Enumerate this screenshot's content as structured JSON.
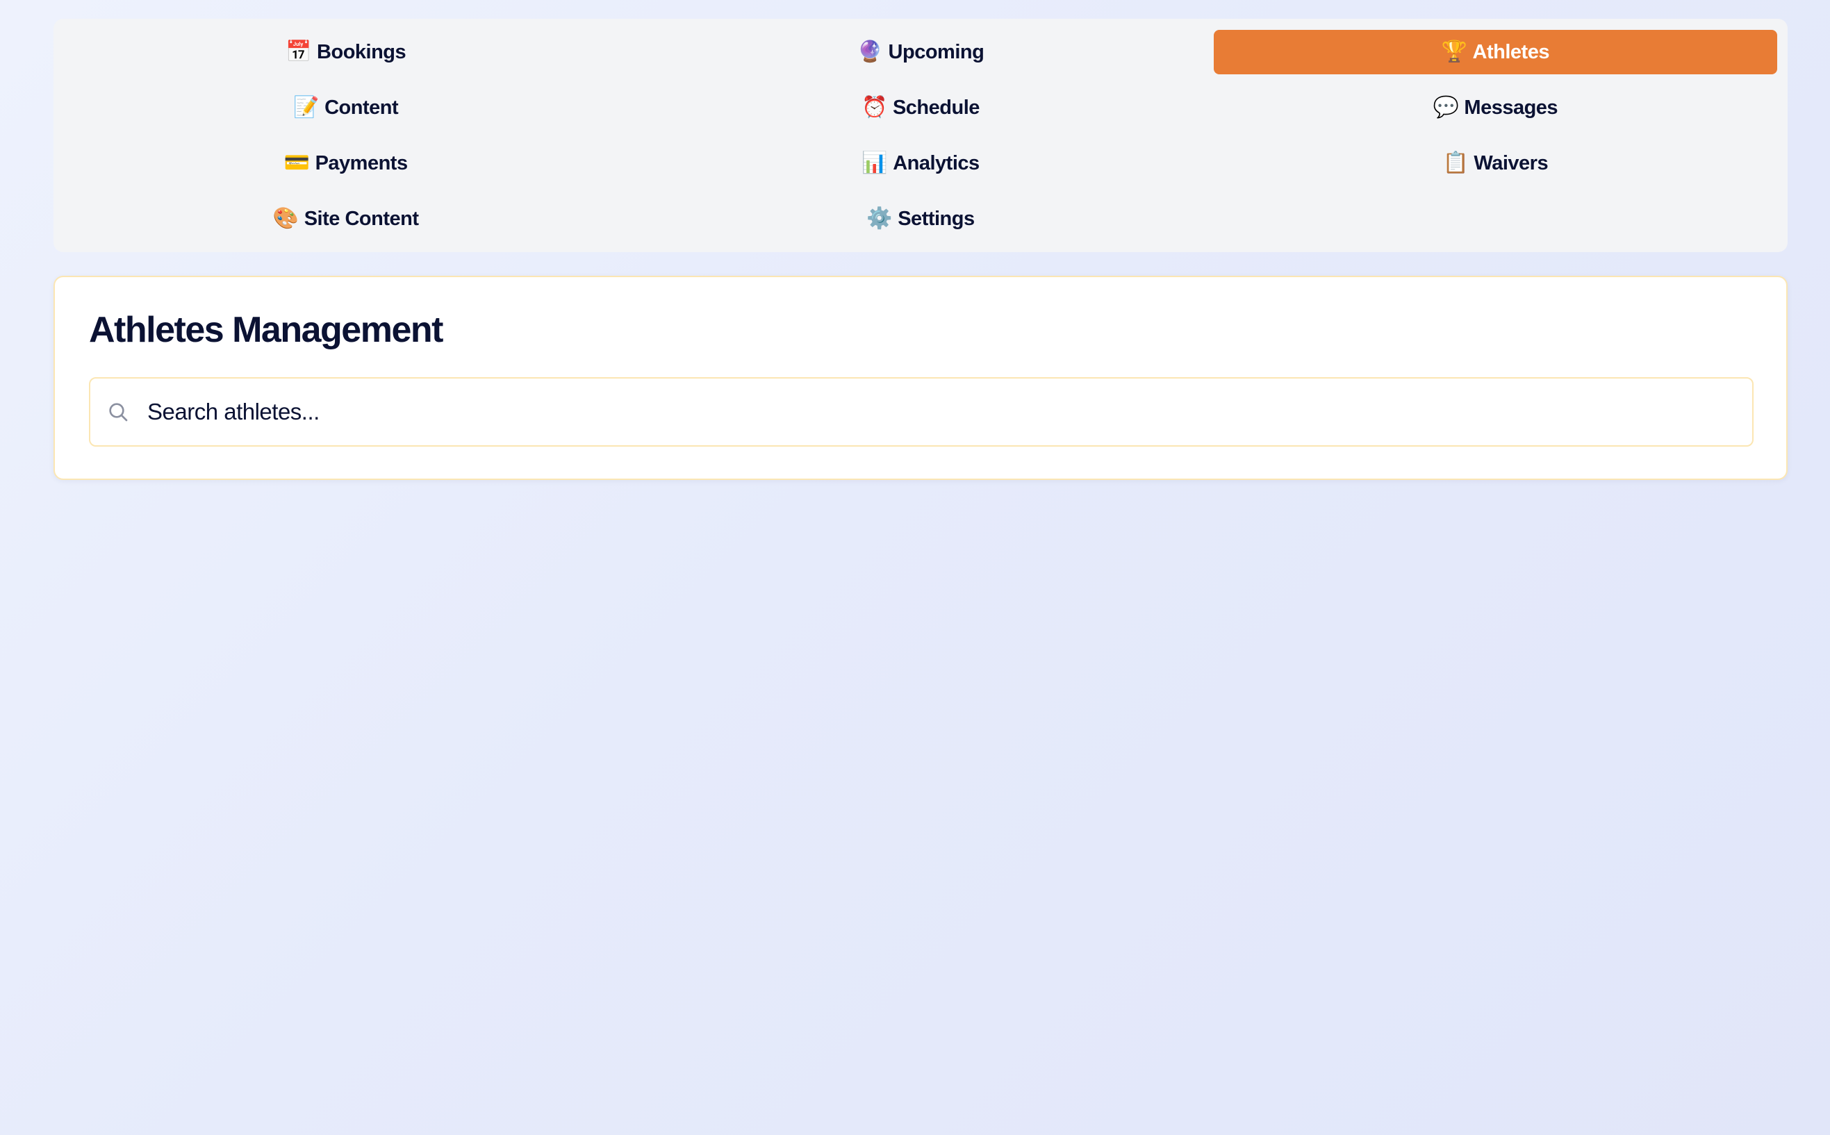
{
  "nav": {
    "items": [
      {
        "icon": "📅",
        "icon_name": "calendar-icon",
        "label": "Bookings",
        "active": false
      },
      {
        "icon": "🔮",
        "icon_name": "crystal-ball-icon",
        "label": "Upcoming",
        "active": false
      },
      {
        "icon": "🏆",
        "icon_name": "trophy-icon",
        "label": "Athletes",
        "active": true
      },
      {
        "icon": "📝",
        "icon_name": "memo-icon",
        "label": "Content",
        "active": false
      },
      {
        "icon": "⏰",
        "icon_name": "alarm-clock-icon",
        "label": "Schedule",
        "active": false
      },
      {
        "icon": "💬",
        "icon_name": "speech-bubble-icon",
        "label": "Messages",
        "active": false
      },
      {
        "icon": "💳",
        "icon_name": "credit-card-icon",
        "label": "Payments",
        "active": false
      },
      {
        "icon": "📊",
        "icon_name": "bar-chart-icon",
        "label": "Analytics",
        "active": false
      },
      {
        "icon": "📋",
        "icon_name": "clipboard-icon",
        "label": "Waivers",
        "active": false
      },
      {
        "icon": "🎨",
        "icon_name": "palette-icon",
        "label": "Site Content",
        "active": false
      },
      {
        "icon": "⚙️",
        "icon_name": "gear-icon",
        "label": "Settings",
        "active": false
      }
    ],
    "active_color": "#e87c35"
  },
  "main": {
    "title": "Athletes Management",
    "search": {
      "placeholder": "Search athletes...",
      "value": "",
      "icon_name": "search-icon"
    }
  },
  "colors": {
    "accent": "#e87c35",
    "card_border": "#fbe6b3",
    "text": "#0b1233"
  }
}
